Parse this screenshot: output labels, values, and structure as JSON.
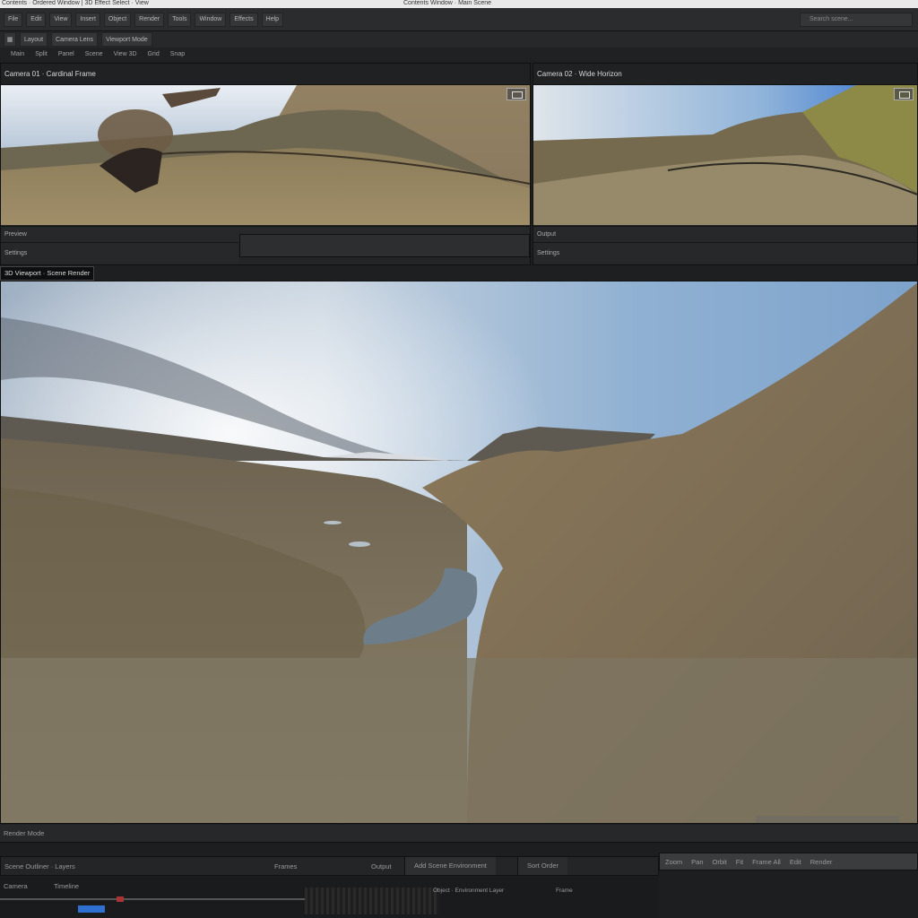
{
  "window": {
    "title_left": "Contents · Ordered  Window  |  3D Effect  Select  ·  View",
    "title_center": "Contents Window · Main Scene"
  },
  "toolbar": {
    "buttons": [
      "File",
      "Edit",
      "View",
      "Insert",
      "Object",
      "Render",
      "Tools",
      "Window",
      "Effects",
      "Help"
    ],
    "search_placeholder": "Search scene..."
  },
  "toolbar2": {
    "buttons": [
      "Layout",
      "Camera  Lens",
      "Viewport Mode"
    ]
  },
  "toolbar3": {
    "items": [
      "Main",
      "Split",
      "Panel",
      "Scene",
      "View 3D",
      "Grid",
      "Snap"
    ]
  },
  "left_preview": {
    "title": "Camera 01 · Cardinal Frame",
    "label": "Preview",
    "footer_text": "Settings"
  },
  "right_preview": {
    "title": "Camera 02 · Wide Horizon",
    "label": "Output",
    "footer_text": "Settings"
  },
  "main_view": {
    "label": "3D Viewport · Scene Render"
  },
  "status": {
    "text": "Render Mode"
  },
  "bottom": {
    "row1_left": "Scene Outliner · Layers",
    "row1_mid1": "Frames",
    "row1_mid2": "Output",
    "row1_tab1": "Add Scene Environment",
    "row1_tab2": "Sort Order",
    "row2_left": "Camera",
    "row2_mid": "Timeline",
    "row2_info": "Object · Environment Layer",
    "row2_right": "Frame",
    "right_buttons": [
      "Zoom",
      "Pan",
      "Orbit",
      "Fit",
      "Frame All",
      "Edit",
      "Render"
    ]
  },
  "colors": {
    "accent": "#2f6fd0",
    "panel": "#232527"
  }
}
